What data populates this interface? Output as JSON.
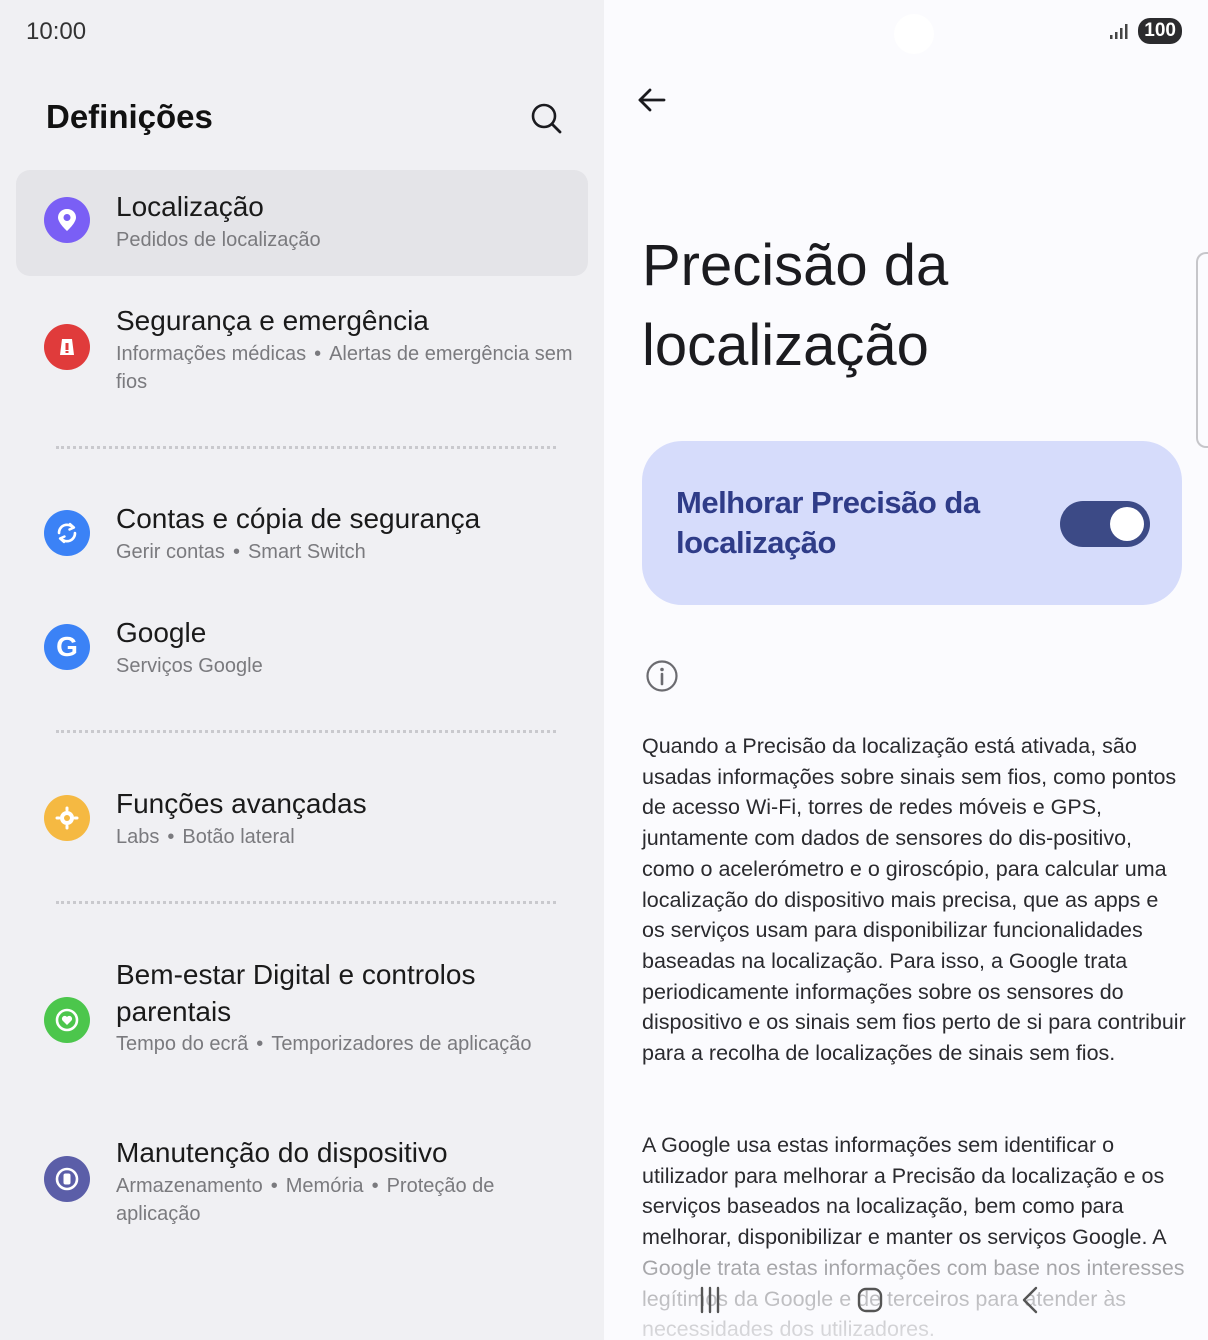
{
  "status_bar": {
    "time": "10:00",
    "battery": "100"
  },
  "settings": {
    "title": "Definições",
    "items": [
      {
        "title": "Localização",
        "subtitle": [
          "Pedidos de localização"
        ],
        "icon": "location-icon",
        "color": "#7a5ff5"
      },
      {
        "title": "Segurança e emergência",
        "subtitle": [
          "Informações médicas",
          "Alertas de emergência sem fios"
        ],
        "icon": "emergency-icon",
        "color": "#e03b3b"
      },
      {
        "title": "Contas e cópia de segurança",
        "subtitle": [
          "Gerir contas",
          "Smart Switch"
        ],
        "icon": "sync-icon",
        "color": "#3b82f6"
      },
      {
        "title": "Google",
        "subtitle": [
          "Serviços Google"
        ],
        "icon": "google-icon",
        "color": "#3b82f6"
      },
      {
        "title": "Funções avançadas",
        "subtitle": [
          "Labs",
          "Botão lateral"
        ],
        "icon": "advanced-features-icon",
        "color": "#f5b942"
      },
      {
        "title": "Bem-estar Digital e controlos parentais",
        "subtitle": [
          "Tempo do ecrã",
          "Temporizadores de aplicação"
        ],
        "icon": "wellbeing-icon",
        "color": "#4cc64c"
      },
      {
        "title": "Manutenção do dispositivo",
        "subtitle": [
          "Armazenamento",
          "Memória",
          "Proteção de aplicação"
        ],
        "icon": "device-care-icon",
        "color": "#5b5ea8"
      }
    ]
  },
  "detail": {
    "title": "Precisão da localização",
    "toggle_label": "Melhorar Precisão da localização",
    "toggle_on": true,
    "paragraphs": [
      "Quando a Precisão da localização está ativada, são usadas informações sobre sinais sem fios, como pontos de acesso Wi-Fi, torres de redes móveis e GPS, juntamente com dados de sensores do dis-positivo, como o acelerómetro e o giroscópio, para calcular uma localização do dispositivo mais precisa, que as apps e os serviços usam para disponibilizar funcionalidades baseadas na localização. Para isso, a Google trata periodicamente informações sobre os sensores do dispositivo e os sinais sem fios perto de si para contribuir para a recolha de localizações de sinais sem fios.",
      "A Google usa estas informações sem identificar o utilizador para melhorar a Precisão da localização e os serviços baseados na localização, bem como para melhorar, disponibilizar e manter os serviços Google. A Google trata estas informações com base nos interesses legítimos da Google e de terceiros para atender às necessidades dos utilizadores."
    ]
  },
  "colors": {
    "accent": "#3c4a86",
    "card": "#d6dcfb",
    "card_text": "#2f3c88"
  }
}
